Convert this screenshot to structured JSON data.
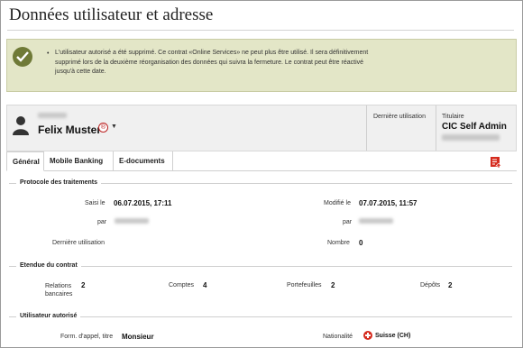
{
  "page": {
    "title": "Données utilisateur et adresse"
  },
  "notice": {
    "bullet": "•",
    "message": "L'utilisateur autorisé a été supprimé. Ce contrat «Online Services» ne peut plus être utilisé. Il sera définitivement supprimé lors de la deuxième réorganisation des données qui suivra la fermeture. Le contrat peut être réactivé jusqu'à cette date.",
    "icon": "check-icon",
    "color": "#e3e6c7"
  },
  "user": {
    "name": "Felix Muster",
    "badge": "®",
    "caret": "▼",
    "last_use_label": "Dernière utilisation",
    "holder_label": "Titulaire",
    "holder_value": "CIC Self Admin"
  },
  "tabs": [
    {
      "label": "Général",
      "active": true
    },
    {
      "label": "Mobile Banking",
      "active": false
    },
    {
      "label": "E-documents",
      "active": false
    }
  ],
  "protocol": {
    "title": "Protocole des traitements",
    "entered_label": "Saisi le",
    "entered_value": "06.07.2015, 17:11",
    "modified_label": "Modifié le",
    "modified_value": "07.07.2015, 11:57",
    "by_label": "par",
    "by_label_2": "par",
    "last_use_label": "Dernière utilisation",
    "count_label": "Nombre",
    "count_value": "0"
  },
  "contract": {
    "title": "Etendue du contrat",
    "relations_label": "Relations bancaires",
    "relations_value": "2",
    "accounts_label": "Comptes",
    "accounts_value": "4",
    "portfolios_label": "Portefeuilles",
    "portfolios_value": "2",
    "deposits_label": "Dépôts",
    "deposits_value": "2"
  },
  "authorized": {
    "title": "Utilisateur autorisé",
    "salutation_label": "Form. d'appel, titre",
    "salutation_value": "Monsieur",
    "nationality_label": "Nationalité",
    "nationality_value": "Suisse (CH)"
  },
  "colors": {
    "accent_red": "#d52b1e",
    "notice_green": "#6f7a37"
  }
}
